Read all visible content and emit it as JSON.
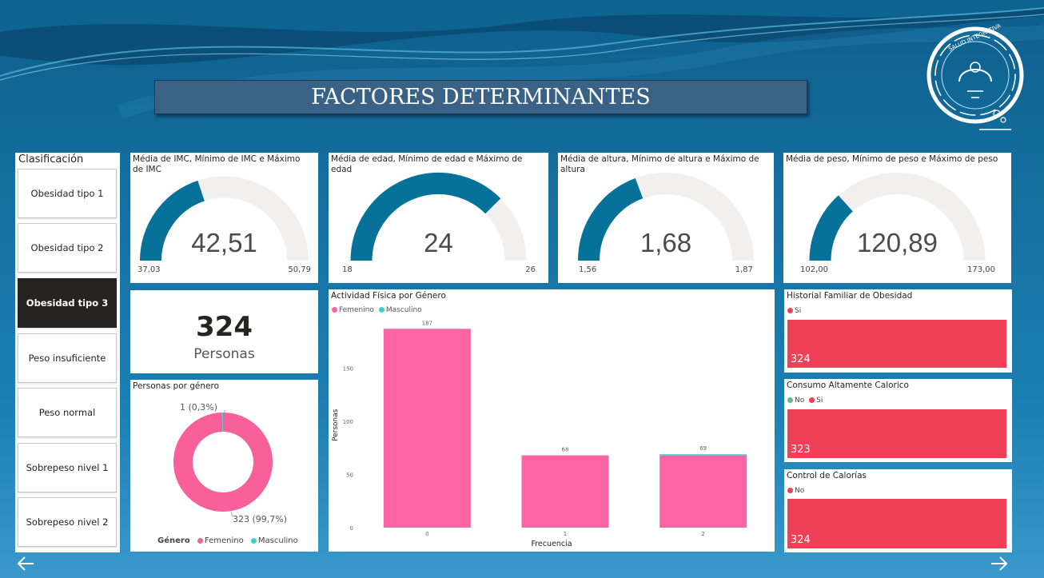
{
  "header": {
    "title": "FACTORES DETERMINANTES",
    "logo_text": "SALUD INTEGRATIVA"
  },
  "slicer": {
    "title": "Clasificación",
    "items": [
      "Obesidad tipo 1",
      "Obesidad tipo 2",
      "Obesidad tipo 3",
      "Peso insuficiente",
      "Peso normal",
      "Sobrepeso nivel 1",
      "Sobrepeso nivel 2"
    ],
    "selected": "Obesidad tipo 3"
  },
  "gauges": [
    {
      "title": "Média de IMC, Mínimo de IMC e Máximo de IMC",
      "value": "42,51",
      "min": "37,03",
      "max": "50,79",
      "value_num": 42.51,
      "min_num": 37.03,
      "max_num": 50.79
    },
    {
      "title": "Média de edad, Mínimo de edad e Máximo de edad",
      "value": "24",
      "min": "18",
      "max": "26",
      "value_num": 24,
      "min_num": 18,
      "max_num": 26
    },
    {
      "title": "Média de altura, Mínimo de altura e Máximo de altura",
      "value": "1,68",
      "min": "1,56",
      "max": "1,87",
      "value_num": 1.68,
      "min_num": 1.56,
      "max_num": 1.87
    },
    {
      "title": "Média de peso, Mínimo de peso e Máximo de peso",
      "value": "120,89",
      "min": "102,00",
      "max": "173,00",
      "value_num": 120.89,
      "min_num": 102,
      "max_num": 173
    }
  ],
  "card": {
    "value": "324",
    "label": "Personas"
  },
  "donut": {
    "title": "Personas por género",
    "legend_title": "Género",
    "labels": [
      "Femenino",
      "Masculino"
    ],
    "values": [
      323,
      1
    ],
    "data_labels": [
      "323 (99,7%)",
      "1 (0,3%)"
    ],
    "colors": [
      "#f7609b",
      "#3ad0c9"
    ]
  },
  "bar_panels": [
    {
      "title": "Historial Familiar de Obesidad",
      "legend": [
        {
          "label": "Si",
          "color": "#f03e55"
        }
      ],
      "total": "324"
    },
    {
      "title": "Consumo Altamente Calorico",
      "legend": [
        {
          "label": "No",
          "color": "#5fb88a"
        },
        {
          "label": "Si",
          "color": "#f03e55"
        }
      ],
      "total": "323"
    },
    {
      "title": "Control de Calorías",
      "legend": [
        {
          "label": "No",
          "color": "#f03e55"
        }
      ],
      "total": "324"
    }
  ],
  "colors": {
    "gauge_fill": "#06729a",
    "gauge_bg": "#f1f0ef",
    "bar_red": "#ef4058",
    "femenino": "#fe64a3",
    "masculino": "#3ad0c9"
  },
  "chart_data": {
    "type": "bar",
    "title": "Actividad Física por Género",
    "xlabel": "Frecuencia",
    "ylabel": "Personas",
    "categories": [
      "0",
      "1",
      "2"
    ],
    "series": [
      {
        "name": "Femenino",
        "values": [
          187,
          68,
          68
        ]
      },
      {
        "name": "Masculino",
        "values": [
          0,
          0,
          1
        ]
      }
    ],
    "data_labels": [
      "187",
      "68",
      "69"
    ],
    "yticks": [
      0,
      50,
      100,
      150
    ],
    "ylim": [
      0,
      200
    ],
    "legend": "top-left",
    "grid": false
  }
}
